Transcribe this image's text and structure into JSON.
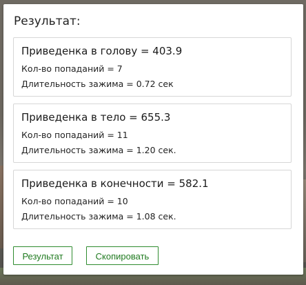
{
  "panel": {
    "title": "Результат:"
  },
  "cards": [
    {
      "heading": "Приведенка в голову = 403.9",
      "hits": "Кол-во попаданий = 7",
      "duration": "Длительность зажима = 0.72 сек"
    },
    {
      "heading": "Приведенка в тело = 655.3",
      "hits": "Кол-во попаданий = 11",
      "duration": "Длительность зажима = 1.20 сек."
    },
    {
      "heading": "Приведенка в конечности = 582.1",
      "hits": "Кол-во попаданий = 10",
      "duration": "Длительность зажима = 1.08 сек."
    }
  ],
  "buttons": {
    "result_label": "Результат",
    "copy_label": "Скопировать"
  },
  "colors": {
    "accent": "#2e8b2e",
    "panel_bg": "#ffffff",
    "card_border": "#d6d6d6"
  }
}
